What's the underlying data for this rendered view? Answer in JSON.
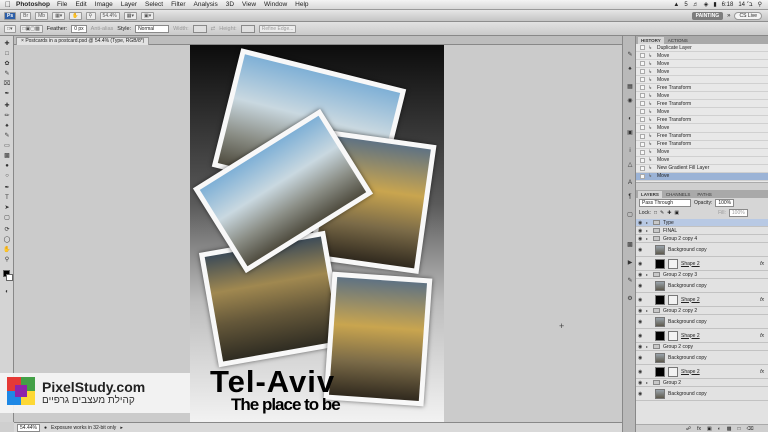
{
  "menubar": {
    "app_name": "Photoshop",
    "items": [
      "File",
      "Edit",
      "Image",
      "Layer",
      "Select",
      "Filter",
      "Analysis",
      "3D",
      "View",
      "Window",
      "Help"
    ],
    "status_right": [
      "5",
      "6:18",
      "14 ב׳"
    ]
  },
  "appbar": {
    "zoom": "54.4%",
    "workspace": "PAINTING",
    "search": "CS Live"
  },
  "optionbar": {
    "feather_label": "Feather:",
    "feather_value": "0 px",
    "antialias_label": "Anti-alias",
    "style_label": "Style:",
    "style_value": "Normal",
    "width_label": "Width:",
    "height_label": "Height:",
    "refine_label": "Refine Edge..."
  },
  "document": {
    "tab_title": "Postcards in a postcard.psd @ 54.4% (Type, RGB/8*)",
    "title_line1": "Tel-Aviv",
    "title_line2": "The place to be"
  },
  "watermark": {
    "brand": "PixelStudy.com",
    "hebrew": "קהילת מעצבים גרפיים"
  },
  "statusbar": {
    "zoom": "54.44%",
    "info": "Exposure works in 32-bit only"
  },
  "history": {
    "tabs": [
      "HISTORY",
      "ACTIONS"
    ],
    "items": [
      "Duplicate Layer",
      "Move",
      "Move",
      "Move",
      "Move",
      "Free Transform",
      "Move",
      "Free Transform",
      "Move",
      "Free Transform",
      "Move",
      "Free Transform",
      "Free Transform",
      "Move",
      "Move",
      "New Gradient Fill Layer",
      "Move"
    ],
    "selected_index": 16
  },
  "layers": {
    "tabs": [
      "LAYERS",
      "CHANNELS",
      "PATHS"
    ],
    "blend_mode": "Pass Through",
    "opacity_label": "Opacity:",
    "opacity_value": "100%",
    "lock_label": "Lock:",
    "fill_label": "Fill:",
    "fill_value": "100%",
    "rows": [
      {
        "kind": "grp",
        "name": "Type",
        "selected": true
      },
      {
        "kind": "grp",
        "name": "FINAL"
      },
      {
        "kind": "grp",
        "name": "Group 2 copy 4"
      },
      {
        "kind": "img",
        "name": "Background copy"
      },
      {
        "kind": "shape",
        "name": "Shape 2",
        "fx": "fx"
      },
      {
        "kind": "grp",
        "name": "Group 2 copy 3"
      },
      {
        "kind": "img",
        "name": "Background copy"
      },
      {
        "kind": "shape",
        "name": "Shape 2",
        "fx": "fx"
      },
      {
        "kind": "grp",
        "name": "Group 2 copy 2"
      },
      {
        "kind": "img",
        "name": "Background copy"
      },
      {
        "kind": "shape",
        "name": "Shape 2",
        "fx": "fx"
      },
      {
        "kind": "grp",
        "name": "Group 2 copy"
      },
      {
        "kind": "img",
        "name": "Background copy"
      },
      {
        "kind": "shape",
        "name": "Shape 2",
        "fx": "fx"
      },
      {
        "kind": "grp",
        "name": "Group 2"
      },
      {
        "kind": "img",
        "name": "Background copy"
      }
    ]
  },
  "colors": {
    "canvas_bg": "#cbcbcb",
    "selection": "#9bb3d6",
    "layer_selection": "#b8c9e4"
  }
}
